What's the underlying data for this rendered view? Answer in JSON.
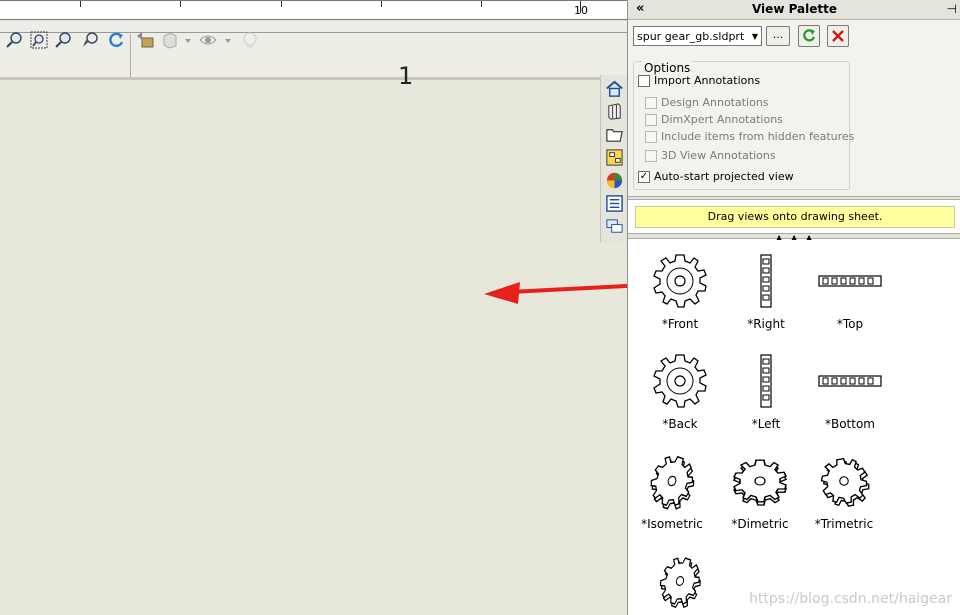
{
  "ruler": {
    "label": "10"
  },
  "sheet": {
    "label": "1"
  },
  "palette": {
    "title": "View Palette",
    "file": "spur gear_gb.sldprt",
    "browse_label": "...",
    "options_title": "Options",
    "options": [
      {
        "label": "Import Annotations",
        "checked": false,
        "enabled": true
      },
      {
        "label": "Design Annotations",
        "checked": false,
        "enabled": false
      },
      {
        "label": "DimXpert Annotations",
        "checked": false,
        "enabled": false
      },
      {
        "label": "Include items from hidden features",
        "checked": false,
        "enabled": false
      },
      {
        "label": "3D View Annotations",
        "checked": false,
        "enabled": false
      },
      {
        "label": "Auto-start projected view",
        "checked": true,
        "enabled": true
      }
    ],
    "hint": "Drag views onto drawing sheet.",
    "views": [
      "*Front",
      "*Right",
      "*Top",
      "*Back",
      "*Left",
      "*Bottom",
      "*Isometric",
      "*Dimetric",
      "*Trimetric"
    ]
  },
  "colors": {
    "arrow": "#e8201c",
    "hint_bg": "#ffff9c",
    "close_x": "#d01818",
    "refresh": "#1f9a2f"
  },
  "watermark": "https://blog.csdn.net/haigear"
}
